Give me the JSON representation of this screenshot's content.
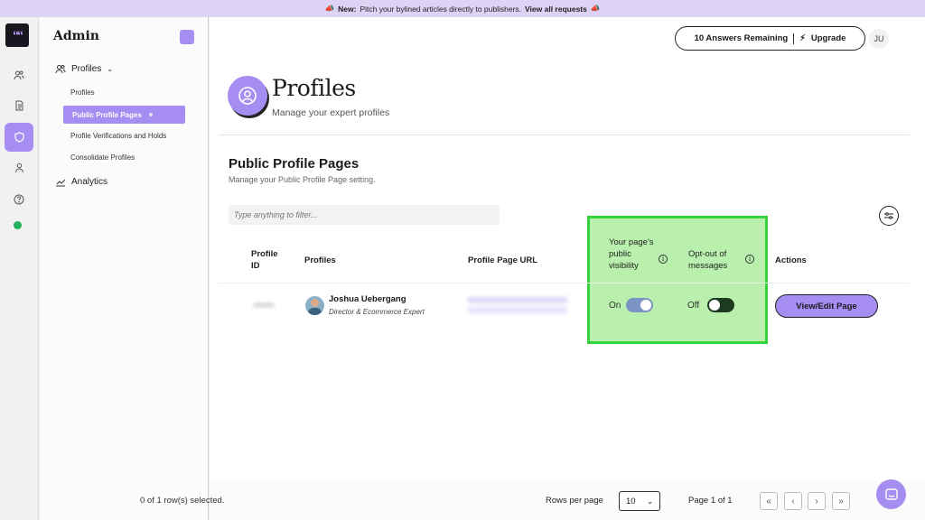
{
  "banner": {
    "label": "New:",
    "text": "Pitch your bylined articles directly to publishers.",
    "link": "View all requests"
  },
  "logo": {
    "glyph": "““"
  },
  "sidebar": {
    "title": "Admin",
    "profiles_header": "Profiles",
    "items": [
      {
        "label": "Profiles"
      },
      {
        "label": "Public Profile Pages"
      },
      {
        "label": "Profile Verifications and Holds"
      },
      {
        "label": "Consolidate Profiles"
      }
    ],
    "analytics": "Analytics"
  },
  "header": {
    "answers": "10 Answers Remaining",
    "upgrade": "Upgrade",
    "user_initials": "JU"
  },
  "page": {
    "title": "Profiles",
    "subtitle": "Manage your expert profiles"
  },
  "section": {
    "title": "Public Profile Pages",
    "subtitle": "Manage your Public Profile Page setting.",
    "filter_placeholder": "Type anything to filter..."
  },
  "table": {
    "headers": {
      "id": "Profile ID",
      "profiles": "Profiles",
      "url": "Profile Page URL",
      "visibility": "Your page's public visibility",
      "optout": "Opt-out of messages",
      "actions": "Actions"
    },
    "rows": [
      {
        "name": "Joshua Uebergang",
        "role": "Director & Ecommerce Expert",
        "visibility_label": "On",
        "visibility_on": true,
        "optout_label": "Off",
        "optout_on": false,
        "action": "View/Edit Page"
      }
    ]
  },
  "footer": {
    "selected": "0 of 1 row(s) selected.",
    "rows_per_page_label": "Rows per page",
    "rows_per_page_value": "10",
    "page_info": "Page 1 of 1"
  },
  "colors": {
    "accent": "#a58df2",
    "highlight_fill": "#b9f0ad",
    "highlight_border": "#35d23b",
    "toggle_on": "#7c93c4",
    "toggle_off": "#1e3b22"
  }
}
